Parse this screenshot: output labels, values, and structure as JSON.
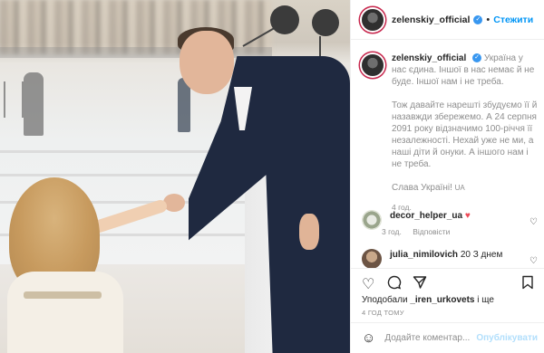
{
  "colors": {
    "accent": "#0095f6",
    "verified": "#3897f0",
    "heart": "#ed4956",
    "muted": "#8e8e8e",
    "text": "#262626"
  },
  "post": {
    "author": "zelenskiy_official",
    "follow_label": "Стежити",
    "caption": {
      "line1": "Україна у нас єдина. Іншої в нас немає й не буде. Іншої нам і не треба.",
      "line2": "Тож давайте нарешті збудуємо її й назавжди збережемо. А 24 серпня 2091 року відзначимо 100-річчя її незалежності. Нехай уже не ми, а наші діти й онуки. А іншого нам і не треба.",
      "line3": "Слава Україні!",
      "flag": "UA",
      "time": "4 год."
    },
    "comments": [
      {
        "user": "decor_helper_ua",
        "text": "",
        "emoji": "heart-icon",
        "time": "3 год.",
        "reply": "Відповісти"
      },
      {
        "user": "julia_nimilovich",
        "text": "20 З днем",
        "emoji": "",
        "time": "",
        "reply": ""
      }
    ],
    "likes": {
      "prefix": "Уподобали",
      "user": "_iren_urkovets",
      "suffix": "і ще"
    },
    "time_ago": "4 ГОД ТОМУ",
    "add_comment": {
      "placeholder": "Додайте коментар...",
      "publish_label": "Опублікувати"
    }
  }
}
